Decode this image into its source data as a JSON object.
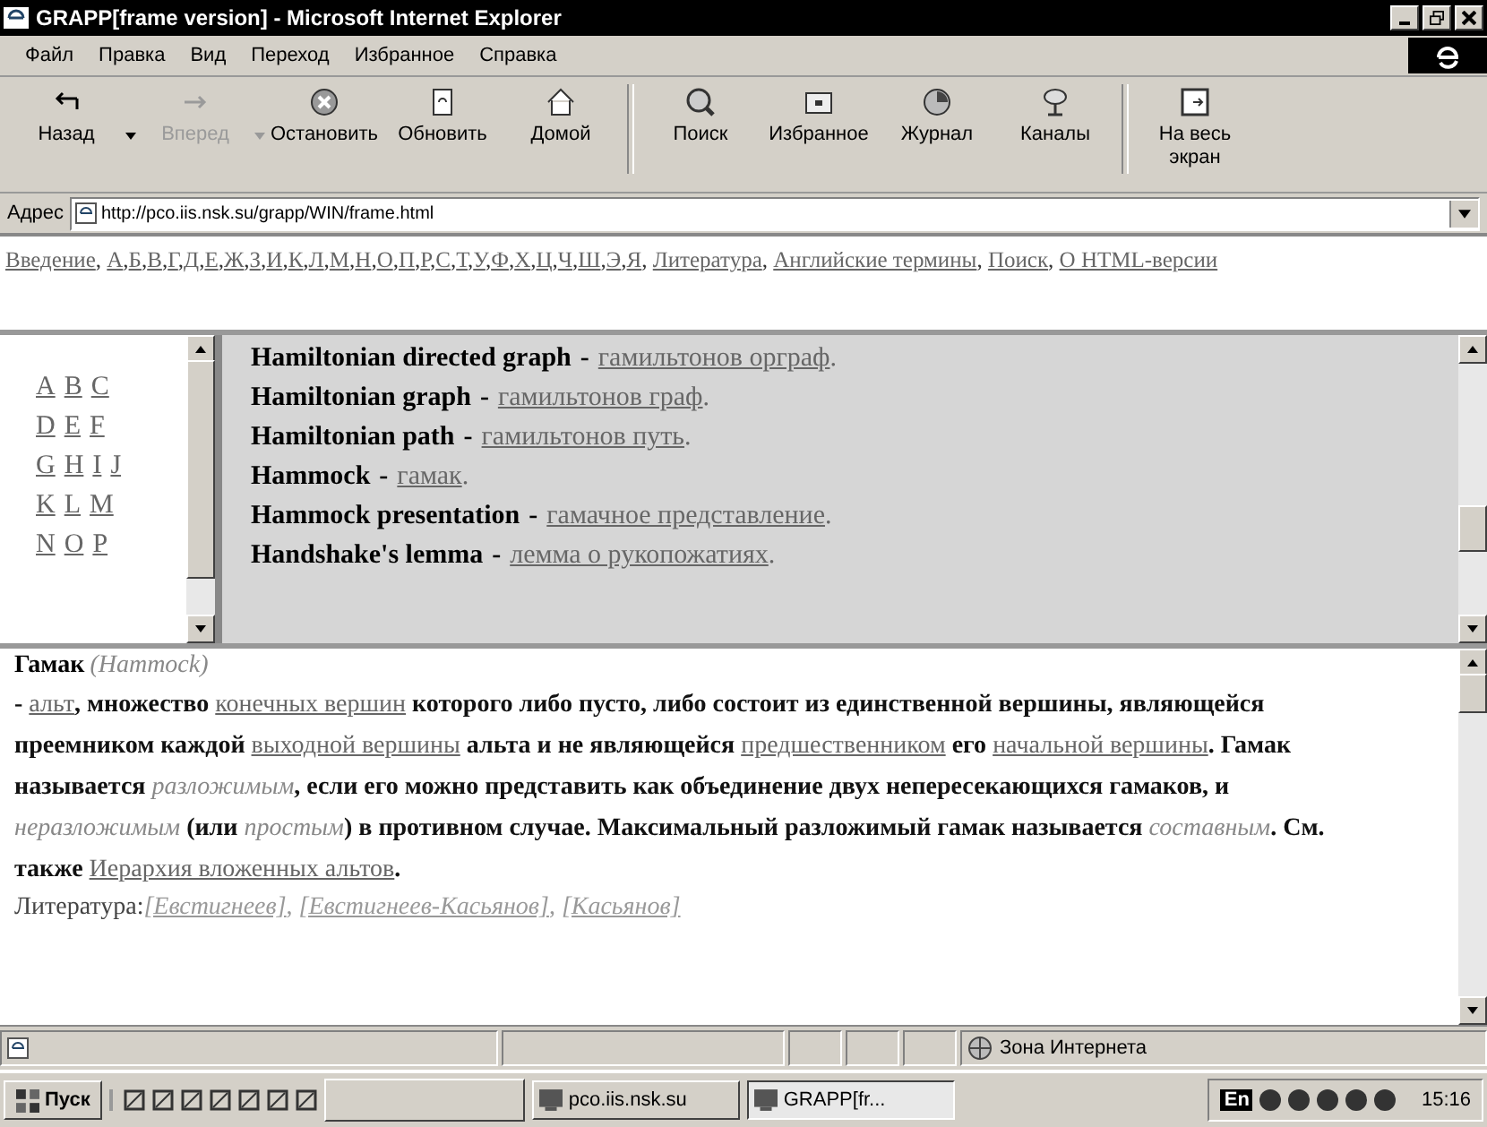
{
  "window": {
    "title": "GRAPP[frame version] - Microsoft Internet Explorer"
  },
  "menu": [
    "Файл",
    "Правка",
    "Вид",
    "Переход",
    "Избранное",
    "Справка"
  ],
  "toolbar": [
    {
      "kind": "back",
      "label": "Назад",
      "disabled": false,
      "dropdown": true
    },
    {
      "kind": "forward",
      "label": "Вперед",
      "disabled": true,
      "dropdown": true
    },
    {
      "kind": "stop",
      "label": "Остановить",
      "disabled": false,
      "dropdown": false
    },
    {
      "kind": "refresh",
      "label": "Обновить",
      "disabled": false,
      "dropdown": false
    },
    {
      "kind": "home",
      "label": "Домой",
      "disabled": false,
      "dropdown": false
    },
    {
      "kind": "search",
      "label": "Поиск",
      "disabled": false,
      "dropdown": false
    },
    {
      "kind": "favorites",
      "label": "Избранное",
      "disabled": false,
      "dropdown": false
    },
    {
      "kind": "history",
      "label": "Журнал",
      "disabled": false,
      "dropdown": false
    },
    {
      "kind": "channels",
      "label": "Каналы",
      "disabled": false,
      "dropdown": false
    },
    {
      "kind": "fullscreen",
      "label": "На весь экран",
      "disabled": false,
      "dropdown": false
    }
  ],
  "address": {
    "label": "Адрес",
    "value": "http://pco.iis.nsk.su/grapp/WIN/frame.html"
  },
  "nav_frame": [
    {
      "text": "Введение",
      "after": ", "
    },
    {
      "text": "А",
      "after": ","
    },
    {
      "text": "Б",
      "after": ","
    },
    {
      "text": "В",
      "after": ","
    },
    {
      "text": "Г",
      "after": ","
    },
    {
      "text": "Д",
      "after": ","
    },
    {
      "text": "Е",
      "after": ","
    },
    {
      "text": "Ж",
      "after": ","
    },
    {
      "text": "З",
      "after": ","
    },
    {
      "text": "И",
      "after": ","
    },
    {
      "text": "К",
      "after": ","
    },
    {
      "text": "Л",
      "after": ","
    },
    {
      "text": "М",
      "after": ","
    },
    {
      "text": "Н",
      "after": ","
    },
    {
      "text": "О",
      "after": ","
    },
    {
      "text": "П",
      "after": ","
    },
    {
      "text": "Р",
      "after": ","
    },
    {
      "text": "С",
      "after": ","
    },
    {
      "text": "Т",
      "after": ","
    },
    {
      "text": "У",
      "after": ","
    },
    {
      "text": "Ф",
      "after": ","
    },
    {
      "text": "Х",
      "after": ","
    },
    {
      "text": "Ц",
      "after": ","
    },
    {
      "text": "Ч",
      "after": ","
    },
    {
      "text": "Ш",
      "after": ","
    },
    {
      "text": "Э",
      "after": ","
    },
    {
      "text": "Я",
      "after": ", "
    },
    {
      "text": "Литература",
      "after": ", "
    },
    {
      "text": "Английские термины",
      "after": ", "
    },
    {
      "text": "Поиск",
      "after": ", "
    },
    {
      "text": "О HTML-версии"
    }
  ],
  "alphabet_frame": [
    [
      "A",
      "B",
      "C"
    ],
    [
      "D",
      "E",
      "F"
    ],
    [
      "G",
      "H",
      "I",
      "J"
    ],
    [
      "K",
      "L",
      "M"
    ],
    [
      "N",
      "O",
      "P"
    ]
  ],
  "terms_frame": [
    {
      "term": "Hamiltonian directed graph",
      "dash": "-",
      "translation": "гамильтонов орграф",
      "end": "."
    },
    {
      "term": "Hamiltonian graph",
      "dash": "-",
      "translation": "гамильтонов граф",
      "end": "."
    },
    {
      "term": "Hamiltonian path",
      "dash": "-",
      "translation": "гамильтонов путь",
      "end": "."
    },
    {
      "term": "Hammock",
      "dash": "-",
      "translation": "гамак",
      "end": "."
    },
    {
      "term": "Hammock presentation",
      "dash": "-",
      "translation": "гамачное представление",
      "end": "."
    },
    {
      "term": "Handshake's lemma",
      "dash": "-",
      "translation": "лемма о рукопожатиях",
      "end": "."
    }
  ],
  "article": {
    "title": "Гамак",
    "latin": "(Hammock)",
    "body": [
      {
        "kind": "text",
        "text": "- "
      },
      {
        "kind": "link",
        "text": "альт"
      },
      {
        "kind": "text",
        "text": ", множество "
      },
      {
        "kind": "link",
        "text": "конечных вершин"
      },
      {
        "kind": "text",
        "text": " которого либо пусто, либо состоит из единственной вершины, являющейся преемником каждой "
      },
      {
        "kind": "link",
        "text": "выходной вершины"
      },
      {
        "kind": "text",
        "text": " альта и не являющейся "
      },
      {
        "kind": "link",
        "text": "предшественником"
      },
      {
        "kind": "text",
        "text": " его "
      },
      {
        "kind": "link",
        "text": "начальной вершины"
      },
      {
        "kind": "text",
        "text": ". Гамак называется "
      },
      {
        "kind": "term",
        "text": "разложимым"
      },
      {
        "kind": "text",
        "text": ", если его можно представить как объединение двух непересекающихся гамаков, и "
      },
      {
        "kind": "term",
        "text": "неразложимым"
      },
      {
        "kind": "text",
        "text": " (или "
      },
      {
        "kind": "term",
        "text": "простым"
      },
      {
        "kind": "text",
        "text": ") в противном случае. Максимальный разложимый гамак называется "
      },
      {
        "kind": "term",
        "text": "составным"
      },
      {
        "kind": "text",
        "text": ". См. также "
      },
      {
        "kind": "link",
        "text": "Иерархия вложенных альтов"
      },
      {
        "kind": "text",
        "text": "."
      }
    ],
    "literature_label": "Литература:",
    "literature": [
      {
        "text": "[Евстигнеев]",
        "after": ", "
      },
      {
        "text": "[Евстигнеев-Касьянов]",
        "after": ", "
      },
      {
        "text": "[Касьянов]"
      }
    ]
  },
  "status_bar": {
    "zone": "Зона Интернета"
  },
  "taskbar": {
    "start": "Пуск",
    "tasks": [
      {
        "label": "pco.iis.nsk.su",
        "selected": false
      },
      {
        "label": "GRAPP[fr...",
        "selected": true
      }
    ],
    "language": "En",
    "clock": "15:16"
  }
}
